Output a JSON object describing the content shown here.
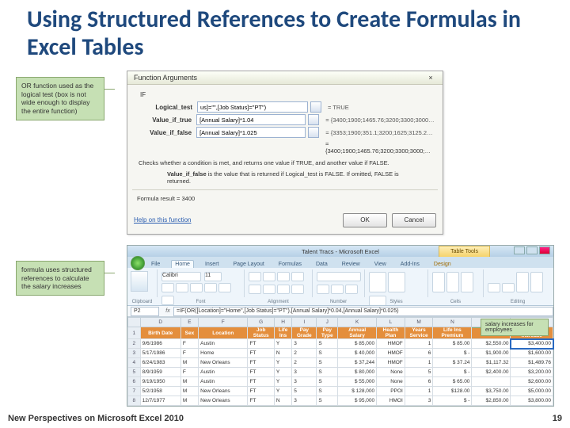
{
  "title": "Using Structured References to Create Formulas in Excel Tables",
  "footer_left": "New Perspectives on Microsoft Excel 2010",
  "footer_right": "19",
  "callout1": "OR function used as the logical test (box is not wide enough to display the entire function)",
  "callout2": "formula uses structured references to calculate the salary increases",
  "dialog": {
    "title": "Function Arguments",
    "if": "IF",
    "labels": {
      "lt": "Logical_test",
      "vt": "Value_if_true",
      "vf": "Value_if_false"
    },
    "vals": {
      "lt": "us]=\"\",[Job Status]=\"PT\")",
      "vt": "[Annual Salary]*1.04",
      "vf": "[Annual Salary]*1.025"
    },
    "eqs": {
      "lt": "= TRUE",
      "vt": "= {3400;1900;1465.76;3200;3300;3000;…",
      "vf": "= {3353;1900;351.1;3200;1625;3125.25…"
    },
    "res_eq": "= {3400;1900;1465.76;3200;3300;3000;…",
    "help1": "Checks whether a condition is met, and returns one value if TRUE, and another value if FALSE.",
    "help2a": "Value_if_false",
    "help2b": " is the value that is returned if Logical_test is FALSE. If omitted, FALSE is returned.",
    "result_label": "Formula result = ",
    "result_val": "3400",
    "help_link": "Help on this function",
    "ok": "OK",
    "cancel": "Cancel",
    "close": "×"
  },
  "excel": {
    "wintitle": "Talent Tracs - Microsoft Excel",
    "tabletools": "Table Tools",
    "tabs": [
      "File",
      "Home",
      "Insert",
      "Page Layout",
      "Formulas",
      "Data",
      "Review",
      "View",
      "Add-Ins",
      "Design"
    ],
    "groups": [
      "Clipboard",
      "Font",
      "Alignment",
      "Number",
      "Styles",
      "Cells",
      "Editing"
    ],
    "font": "Calibri",
    "fsize": "11",
    "namebox": "P2",
    "formula": "=IF(OR([Location]=\"Home\",[Job Status]=\"PT\"),[Annual Salary]*0.04,[Annual Salary]*0.025)",
    "sal_callout": "salary increases for employees",
    "cols": [
      "",
      "D",
      "E",
      "F",
      "G",
      "H",
      "I",
      "J",
      "K",
      "L",
      "M",
      "N",
      "O",
      "P"
    ],
    "hdr": [
      "",
      "Birth Date",
      "Sex",
      "Location",
      "Job\nStatus",
      "Life\nIns",
      "Pay\nGrade",
      "Pay\nType",
      "Annual\nSalary",
      "Health\nPlan",
      "Years\nService",
      "Life Ins\nPremium",
      "401(k)",
      "Salary\nIncrease"
    ],
    "rows": [
      [
        "2",
        "9/6/1986",
        "F",
        "Austin",
        "FT",
        "Y",
        "3",
        "S",
        "$ 85,000",
        "HMOF",
        "1",
        "$ 85.00",
        "$2,550.00",
        "$3,400.00"
      ],
      [
        "3",
        "5/17/1986",
        "F",
        "Home",
        "FT",
        "N",
        "2",
        "S",
        "$ 40,000",
        "HMOF",
        "6",
        "$      -",
        "$1,900.00",
        "$1,600.00"
      ],
      [
        "4",
        "6/24/1983",
        "M",
        "New Orleans",
        "FT",
        "Y",
        "2",
        "S",
        "$ 37,244",
        "HMOF",
        "1",
        "$ 37.24",
        "$1,117.32",
        "$1,489.76"
      ],
      [
        "5",
        "8/9/1959",
        "F",
        "Austin",
        "FT",
        "Y",
        "3",
        "S",
        "$ 80,000",
        "None",
        "5",
        "$      -",
        "$2,400.00",
        "$3,200.00"
      ],
      [
        "6",
        "9/19/1950",
        "M",
        "Austin",
        "FT",
        "Y",
        "3",
        "S",
        "$ 55,000",
        "None",
        "6",
        "$ 65.00",
        "",
        "$2,600.00"
      ],
      [
        "7",
        "5/2/1958",
        "M",
        "New Orleans",
        "FT",
        "Y",
        "5",
        "S",
        "$ 128,000",
        "PPOI",
        "1",
        "$128.00",
        "$3,750.00",
        "$5,000.00"
      ],
      [
        "8",
        "12/7/1977",
        "M",
        "New Orleans",
        "FT",
        "N",
        "3",
        "S",
        "$ 95,000",
        "HMOI",
        "3",
        "$      -",
        "$2,850.00",
        "$3,800.00"
      ]
    ]
  }
}
